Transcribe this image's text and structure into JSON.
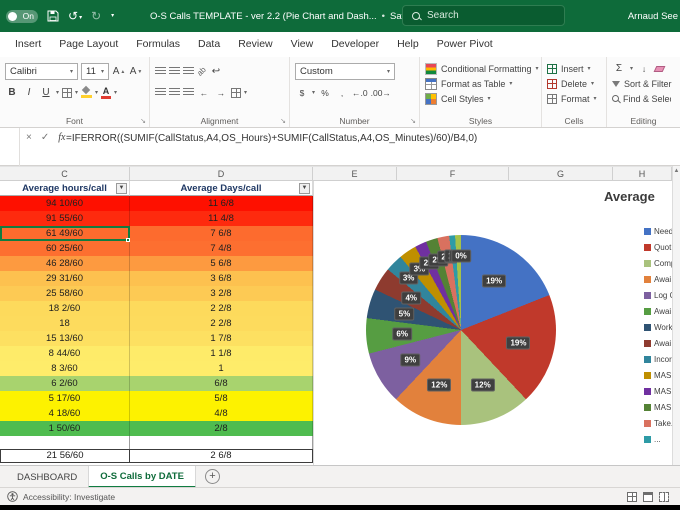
{
  "titlebar": {
    "autosave_state": "On",
    "doc_title": "O-S Calls TEMPLATE - ver 2.2 (Pie Chart and Dash...",
    "saved_status": "Saved",
    "search_placeholder": "Search",
    "user_name": "Arnaud See"
  },
  "menu": {
    "tabs": [
      "Insert",
      "Page Layout",
      "Formulas",
      "Data",
      "Review",
      "View",
      "Developer",
      "Help",
      "Power Pivot"
    ]
  },
  "ribbon": {
    "font_name": "Calibri",
    "font_size": "11",
    "bold": "B",
    "italic": "I",
    "underline": "U",
    "number_format": "Custom",
    "number_buttons": [
      "$",
      "%",
      ",",
      "←.0",
      ".00→"
    ],
    "autosum": "Σ",
    "styles_buttons": [
      "Conditional Formatting",
      "Format as Table",
      "Cell Styles"
    ],
    "cells_buttons": [
      "Insert",
      "Delete",
      "Format"
    ],
    "editing_buttons": [
      "Sort & Filter",
      "Find & Select"
    ],
    "group_labels": [
      "Font",
      "Alignment",
      "Number",
      "Styles",
      "Cells",
      "Editing"
    ]
  },
  "formula_bar": {
    "fx_label": "fx",
    "formula": "=IFERROR((SUMIF(CallStatus,A4,OS_Hours)+SUMIF(CallStatus,A4,OS_Minutes)/60)/B4,0)"
  },
  "grid": {
    "column_letters": [
      "C",
      "D",
      "E",
      "F",
      "G",
      "H"
    ]
  },
  "table": {
    "headers": [
      "Average hours/call",
      "Average Days/call"
    ],
    "rows": [
      {
        "hours": "94 10/60",
        "days": "11 6/8",
        "bg": "#FE1000"
      },
      {
        "hours": "91 55/60",
        "days": "11 4/8",
        "bg": "#FE2A0E"
      },
      {
        "hours": "61 49/60",
        "days": "7 6/8",
        "bg": "#FD6B2E",
        "selected": true
      },
      {
        "hours": "60 25/60",
        "days": "7 4/8",
        "bg": "#FD6F30"
      },
      {
        "hours": "46 28/60",
        "days": "5 6/8",
        "bg": "#FD9A40"
      },
      {
        "hours": "29 31/60",
        "days": "3 6/8",
        "bg": "#FDC14F"
      },
      {
        "hours": "25 58/60",
        "days": "3 2/8",
        "bg": "#FDCA54"
      },
      {
        "hours": "18 2/60",
        "days": "2 2/8",
        "bg": "#FDDA5C"
      },
      {
        "hours": "18",
        "days": "2 2/8",
        "bg": "#FDDB5D"
      },
      {
        "hours": "15 13/60",
        "days": "1 7/8",
        "bg": "#FDE061"
      },
      {
        "hours": "8 44/60",
        "days": "1 1/8",
        "bg": "#FEEB69"
      },
      {
        "hours": "8 3/60",
        "days": "1",
        "bg": "#FEEC6A"
      },
      {
        "hours": "6 2/60",
        "days": "6/8",
        "bg": "#A8D36E"
      },
      {
        "hours": "5 17/60",
        "days": "5/8",
        "bg": "#FDF200"
      },
      {
        "hours": "4 18/60",
        "days": "4/8",
        "bg": "#FDF200"
      },
      {
        "hours": "1 50/60",
        "days": "2/8",
        "bg": "#4FBC4F"
      }
    ],
    "total": {
      "hours": "21 56/60",
      "days": "2 6/8"
    }
  },
  "chart": {
    "title": "Average",
    "chart_data": {
      "type": "pie",
      "title": "Average",
      "values": [
        19,
        19,
        12,
        12,
        9,
        6,
        5,
        4,
        3,
        3,
        2,
        2,
        2,
        1,
        1,
        0
      ],
      "colors": [
        "#4472C4",
        "#C0392B",
        "#A9C27D",
        "#E2813C",
        "#7D60A0",
        "#569D42",
        "#2F5373",
        "#8E3B2F",
        "#31859C",
        "#BF8F00",
        "#7030A0",
        "#548235",
        "#D9715F",
        "#2E9BA6",
        "#A5C249",
        "#8C8C8C"
      ],
      "legend_labels": [
        "Need...",
        "Quot...",
        "Comp...",
        "Awai...",
        "Log C...",
        "Awai...",
        "Work...",
        "Awai...",
        "Incor...",
        "MAS...",
        "MAS...",
        "MAS...",
        "Take...",
        "..."
      ],
      "legend_position": "right",
      "data_labels": "percent"
    }
  },
  "sheets": {
    "tabs": [
      "DASHBOARD",
      "O-S Calls by DATE"
    ],
    "active": "O-S Calls by DATE",
    "add_label": "+"
  },
  "statusbar": {
    "accessibility": "Accessibility: Investigate"
  }
}
